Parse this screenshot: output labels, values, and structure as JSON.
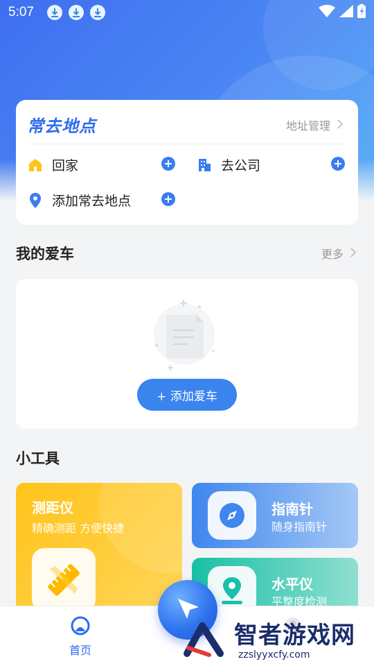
{
  "status_bar": {
    "time": "5:07",
    "icons": [
      "download-icon",
      "download-icon",
      "download-icon",
      "wifi-icon",
      "signal-icon",
      "battery-icon"
    ]
  },
  "colors": {
    "accent": "#2d6cf0",
    "hero_start": "#3f6ff0",
    "hero_end": "#48a6f8",
    "ruler_card": "#ffc31a",
    "compass_card": "#3f86ef",
    "level_card": "#19bfa6"
  },
  "places": {
    "title": "常去地点",
    "manage_label": "地址管理",
    "items": [
      {
        "label": "回家",
        "icon": "home-icon"
      },
      {
        "label": "去公司",
        "icon": "building-icon"
      },
      {
        "label": "添加常去地点",
        "icon": "location-pin-icon"
      }
    ]
  },
  "my_car": {
    "title": "我的爱车",
    "more_label": "更多",
    "add_button": "+ 添加爱车"
  },
  "tools": {
    "title": "小工具",
    "items": [
      {
        "title": "测距仪",
        "subtitle": "精确测距 方便快捷",
        "icon": "ruler-icon"
      },
      {
        "title": "指南针",
        "subtitle": "随身指南针",
        "icon": "compass-icon"
      },
      {
        "title": "水平仪",
        "subtitle": "平整度检测",
        "icon": "level-icon"
      }
    ]
  },
  "bottom_nav": {
    "home_label": "首页"
  },
  "watermark": {
    "text": "智者游戏网",
    "url": "zzslyyxcfy.com"
  }
}
